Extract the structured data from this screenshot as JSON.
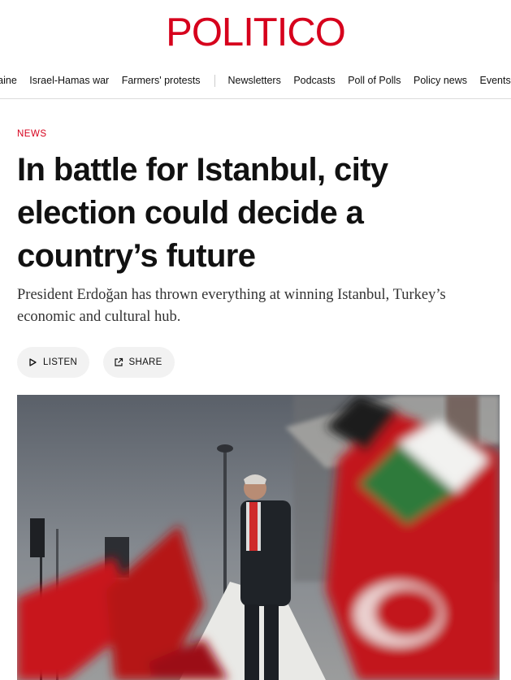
{
  "brand": {
    "logo_text": "POLITICO",
    "accent": "#d6001c"
  },
  "nav": {
    "items": [
      "raine",
      "Israel-Hamas war",
      "Farmers' protests"
    ],
    "secondary": [
      "Newsletters",
      "Podcasts",
      "Poll of Polls",
      "Policy news",
      "Events"
    ]
  },
  "article": {
    "kicker": "NEWS",
    "headline": "In battle for Istanbul, city election could decide a country’s future",
    "dek": "President Erdoğan has thrown everything at winning Istanbul, Turkey’s economic and cultural hub.",
    "actions": {
      "listen_label": "LISTEN",
      "share_label": "SHARE"
    }
  },
  "hero": {
    "icon": "photo-erdogan-rally-flags"
  }
}
